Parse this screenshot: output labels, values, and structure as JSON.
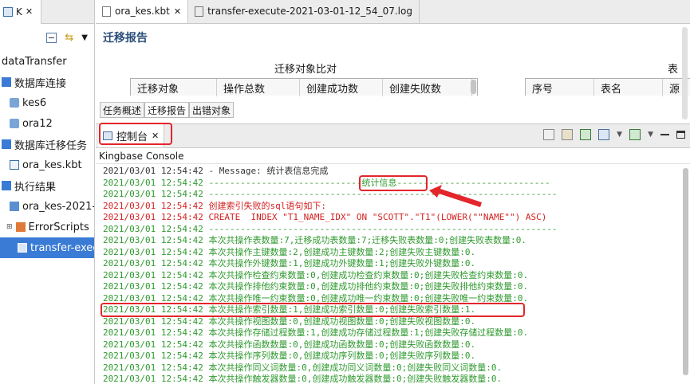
{
  "navigator": {
    "tab_label": "K",
    "root": "dataTransfer",
    "items": [
      {
        "label": "数据库连接"
      },
      {
        "label": "kes6"
      },
      {
        "label": "ora12"
      },
      {
        "label": "数据库迁移任务"
      },
      {
        "label": "ora_kes.kbt"
      },
      {
        "label": "执行结果"
      },
      {
        "label": "ora_kes-2021-0"
      },
      {
        "label": "ErrorScripts"
      },
      {
        "label": "transfer-exec"
      }
    ]
  },
  "editor": {
    "tabs": [
      {
        "label": "ora_kes.kbt"
      },
      {
        "label": "transfer-execute-2021-03-01-12_54_07.log"
      }
    ],
    "report_title": "迁移报告",
    "group_title": "迁移对象比对",
    "group_title_right": "表",
    "columns_left": [
      "迁移对象",
      "操作总数",
      "创建成功数",
      "创建失败数"
    ],
    "columns_right": [
      "序号",
      "表名",
      "源"
    ],
    "subtabs": [
      "任务概述",
      "迁移报告",
      "出错对象"
    ]
  },
  "console": {
    "tab_label": "控制台",
    "name": "Kingbase Console",
    "lines": [
      {
        "ts": "2021/03/01 12:54:42",
        "text": " - Message: 统计表信息完成",
        "color": "dark"
      },
      {
        "ts": "2021/03/01 12:54:42",
        "text": " -----------------------------统计信息-----------------------------",
        "color": "green"
      },
      {
        "ts": "2021/03/01 12:54:42",
        "text": " ------------------------------------------------------------------",
        "color": "green"
      },
      {
        "ts": "2021/03/01 12:54:42",
        "text": " 创建索引失败的sql语句如下:",
        "color": "red"
      },
      {
        "ts": "2021/03/01 12:54:42",
        "text": " CREATE  INDEX \"T1_NAME_IDX\" ON \"SCOTT\".\"T1\"(LOWER(\"\"NAME\"\") ASC)",
        "color": "red"
      },
      {
        "ts": "2021/03/01 12:54:42",
        "text": " ------------------------------------------------------------------",
        "color": "green"
      },
      {
        "ts": "2021/03/01 12:54:42",
        "text": " 本次共操作表数量:7,迁移成功表数量:7;迁移失败表数量:0;创建失败表数量:0.",
        "color": "green"
      },
      {
        "ts": "2021/03/01 12:54:42",
        "text": " 本次共操作主键数量:2,创建成功主键数量:2;创建失败主键数量:0.",
        "color": "green"
      },
      {
        "ts": "2021/03/01 12:54:42",
        "text": " 本次共操作外键数量:1,创建成功外键数量:1;创建失败外键数量:0.",
        "color": "green"
      },
      {
        "ts": "2021/03/01 12:54:42",
        "text": " 本次共操作检查约束数量:0,创建成功检查约束数量:0;创建失败检查约束数量:0.",
        "color": "green"
      },
      {
        "ts": "2021/03/01 12:54:42",
        "text": " 本次共操作排他约束数量:0,创建成功排他约束数量:0;创建失败排他约束数量:0.",
        "color": "green"
      },
      {
        "ts": "2021/03/01 12:54:42",
        "text": " 本次共操作唯一约束数量:0,创建成功唯一约束数量:0;创建失败唯一约束数量:0.",
        "color": "green"
      },
      {
        "ts": "2021/03/01 12:54:42",
        "text": " 本次共操作索引数量:1,创建成功索引数量:0;创建失败索引数量:1.",
        "color": "green"
      },
      {
        "ts": "2021/03/01 12:54:42",
        "text": " 本次共操作视图数量:0,创建成功视图数量:0;创建失败视图数量:0.",
        "color": "green"
      },
      {
        "ts": "2021/03/01 12:54:42",
        "text": " 本次共操作存储过程数量:1,创建成功存储过程数量:1;创建失败存储过程数量:0.",
        "color": "green"
      },
      {
        "ts": "2021/03/01 12:54:42",
        "text": " 本次共操作函数数量:0,创建成功函数数量:0;创建失败函数数量:0.",
        "color": "green"
      },
      {
        "ts": "2021/03/01 12:54:42",
        "text": " 本次共操作序列数量:0,创建成功序列数量:0;创建失败序列数量:0.",
        "color": "green"
      },
      {
        "ts": "2021/03/01 12:54:42",
        "text": " 本次共操作同义词数量:0,创建成功同义词数量:0;创建失败同义词数量:0.",
        "color": "green"
      },
      {
        "ts": "2021/03/01 12:54:42",
        "text": " 本次共操作触发器数量:0,创建成功触发器数量:0;创建失败触发器数量:0.",
        "color": "green"
      }
    ]
  },
  "colors": {
    "accent_selected": "#3a7bd5",
    "log_green": "#2f9a2f",
    "log_red": "#d42020",
    "annotation_red": "#e3262b"
  }
}
